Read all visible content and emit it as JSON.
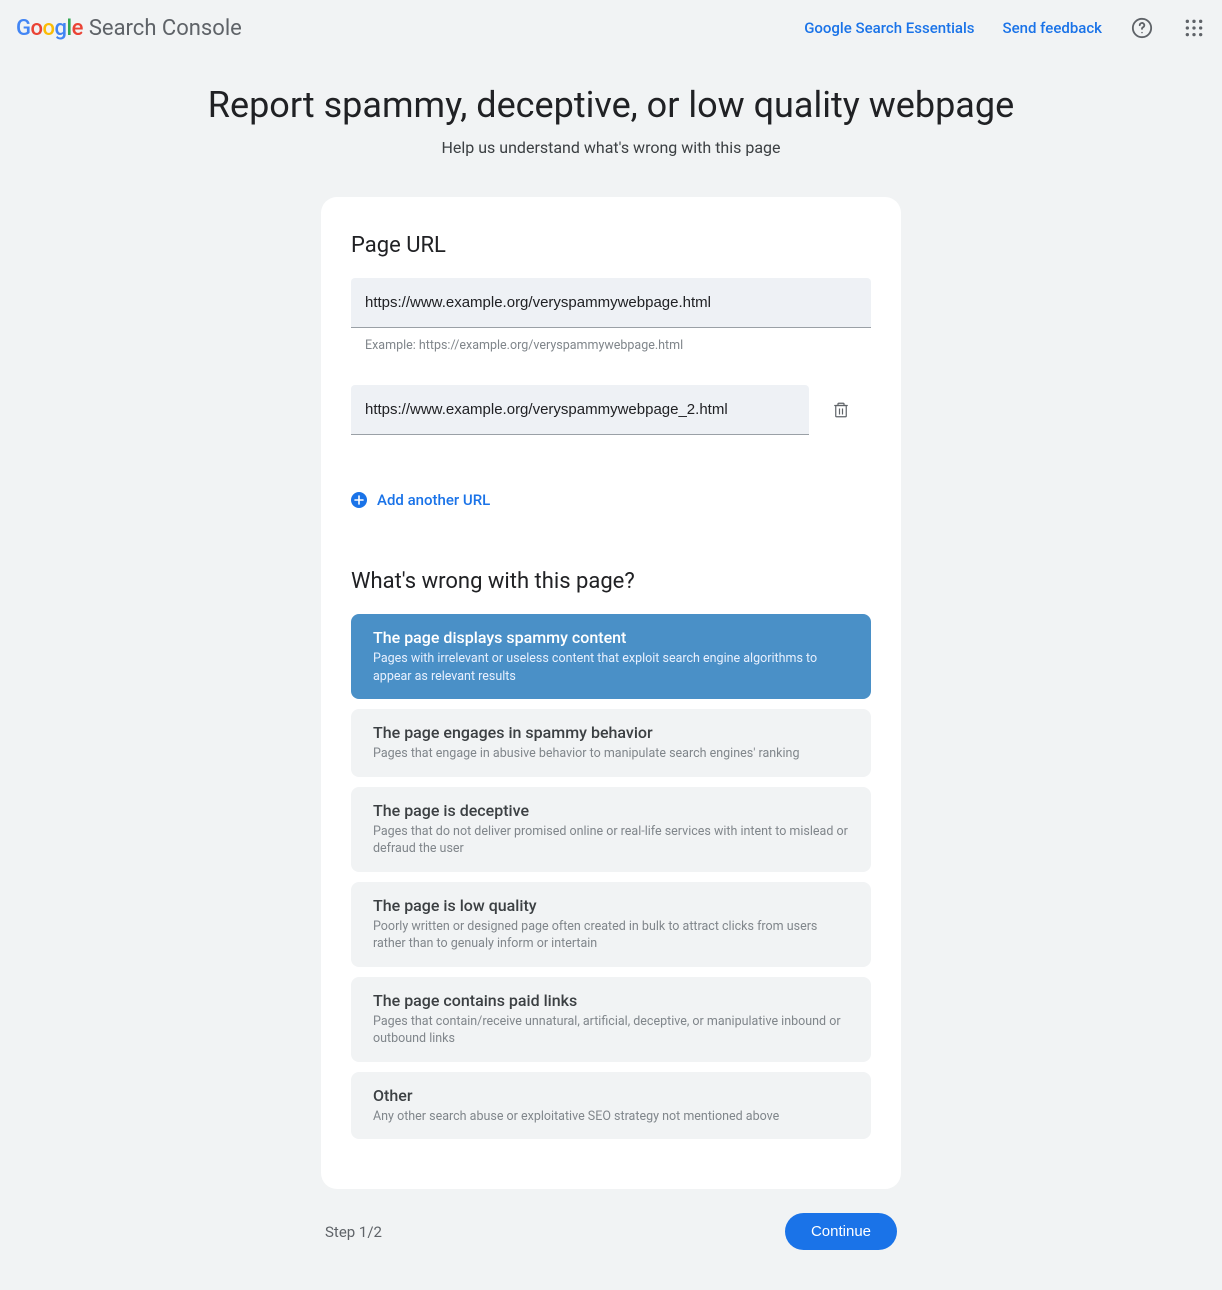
{
  "header": {
    "product_name": "Search Console",
    "link_essentials": "Google Search Essentials",
    "link_feedback": "Send feedback"
  },
  "page": {
    "title": "Report spammy, deceptive, or low quality webpage",
    "subtitle": "Help us understand what's wrong with this page"
  },
  "url_section": {
    "title": "Page URL",
    "urls": [
      "https://www.example.org/veryspammywebpage.html",
      "https://www.example.org/veryspammywebpage_2.html"
    ],
    "helper": "Example: https://example.org/veryspammywebpage.html",
    "add_label": "Add another URL"
  },
  "reason_section": {
    "title": "What's wrong with this page?",
    "options": [
      {
        "title": "The page displays spammy content",
        "desc": "Pages with irrelevant or useless content that exploit search engine algorithms to appear as relevant results",
        "selected": true
      },
      {
        "title": "The page engages in spammy behavior",
        "desc": "Pages that engage in abusive behavior to manipulate search engines' ranking",
        "selected": false
      },
      {
        "title": "The page is deceptive",
        "desc": "Pages that do not deliver promised online or real-life services with intent to mislead or defraud the user",
        "selected": false
      },
      {
        "title": "The page is low quality",
        "desc": "Poorly written or designed page often created in bulk to attract clicks from users rather than to genualy inform or intertain",
        "selected": false
      },
      {
        "title": "The page contains paid links",
        "desc": "Pages that contain/receive unnatural, artificial, deceptive, or manipulative inbound or outbound links",
        "selected": false
      },
      {
        "title": "Other",
        "desc": "Any other search abuse or exploitative SEO strategy not mentioned above",
        "selected": false
      }
    ]
  },
  "footer": {
    "step": "Step 1/2",
    "continue": "Continue"
  }
}
